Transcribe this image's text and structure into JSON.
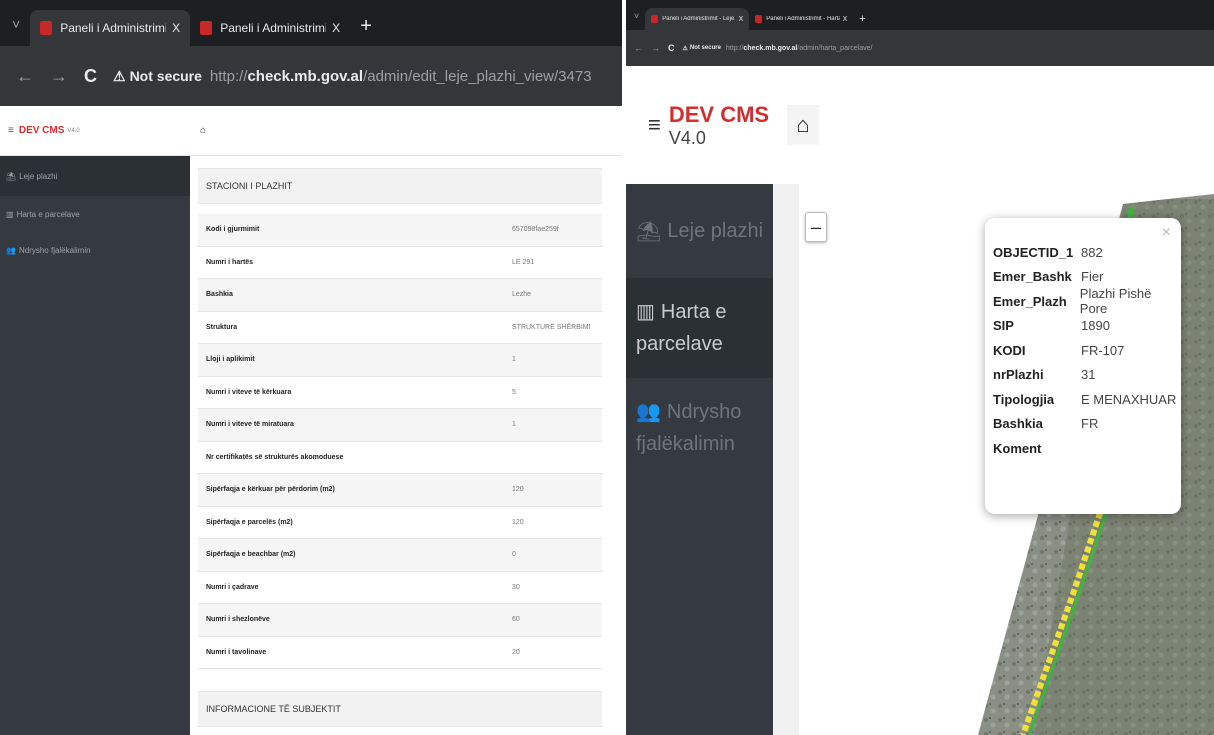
{
  "left": {
    "tabs": [
      {
        "title": "Paneli i Administrimit - Leje Pla",
        "close": "X"
      },
      {
        "title": "Paneli i Administrimit - Ndrysh",
        "close": "X"
      }
    ],
    "new_tab": "+",
    "tab_dropdown": "˅",
    "nav": {
      "back": "←",
      "forward": "→",
      "reload": "C"
    },
    "address": {
      "not_secure": "Not secure",
      "scheme": "http://",
      "host": "check.mb.gov.al",
      "path": "/admin/edit_leje_plazhi_view/3473"
    },
    "cms": {
      "menu": "≡",
      "brand": "DEV CMS",
      "version": "V4.0",
      "home_icon": "⌂"
    },
    "sidebar": [
      {
        "icon": "⛱",
        "label": "Leje plazhi"
      },
      {
        "icon": "▥",
        "label": "Harta e parcelave"
      },
      {
        "icon": "👥",
        "label": "Ndrysho fjalëkalimin"
      }
    ],
    "section1": "STACIONI I PLAZHIT",
    "rows": [
      {
        "k": "Kodi i gjurmimit",
        "v": "657098fae259f"
      },
      {
        "k": "Numri i hartës",
        "v": "LE 291"
      },
      {
        "k": "Bashkia",
        "v": "Lezhe"
      },
      {
        "k": "Struktura",
        "v": "STRUKTURË SHËRBIMI"
      },
      {
        "k": "Lloji i aplikimit",
        "v": "1"
      },
      {
        "k": "Numri i viteve të kërkuara",
        "v": "5"
      },
      {
        "k": "Numri i viteve të miratuara",
        "v": "1"
      },
      {
        "k": "Nr certifikatës së strukturës akomoduese",
        "v": ""
      },
      {
        "k": "Sipërfaqja e kërkuar për përdorim (m2)",
        "v": "120"
      },
      {
        "k": "Sipërfaqja e parcelës (m2)",
        "v": "120"
      },
      {
        "k": "Sipërfaqja e beachbar (m2)",
        "v": "0"
      },
      {
        "k": "Numri i çadrave",
        "v": "30"
      },
      {
        "k": "Numri i shezlonëve",
        "v": "60"
      },
      {
        "k": "Numri i tavolinave",
        "v": "20"
      }
    ],
    "section2": "INFORMACIONE TË SUBJEKTIT"
  },
  "right": {
    "tabs": [
      {
        "title": "Paneli i Administrimit - Leje Pla",
        "close": "X"
      },
      {
        "title": "Paneli i Administrimit - Harta e",
        "close": "X"
      }
    ],
    "new_tab": "+",
    "tab_dropdown": "˅",
    "nav": {
      "back": "←",
      "forward": "→",
      "reload": "C"
    },
    "address": {
      "not_secure": "Not secure",
      "scheme": "http://",
      "host": "check.mb.gov.al",
      "path": "/admin/harta_parcelave/"
    },
    "cms": {
      "menu": "≡",
      "brand": "DEV CMS",
      "version": "V4.0",
      "home_icon": "⌂"
    },
    "sidebar": [
      {
        "icon": "⛱",
        "label": "Leje plazhi"
      },
      {
        "icon": "▥",
        "label": "Harta e parcelave"
      },
      {
        "icon": "👥",
        "label": "Ndrysho fjalëkalimin"
      }
    ],
    "zoom_out": "–",
    "popup": {
      "close": "×",
      "rows": [
        {
          "k": "OBJECTID_1",
          "v": "882"
        },
        {
          "k": "Emer_Bashk",
          "v": "Fier"
        },
        {
          "k": "Emer_Plazh",
          "v": "Plazhi Pishë Pore"
        },
        {
          "k": "SIP",
          "v": "1890"
        },
        {
          "k": "KODI",
          "v": "FR-107"
        },
        {
          "k": "nrPlazhi",
          "v": "31"
        },
        {
          "k": "Tipologjia",
          "v": "E MENAXHUAR"
        },
        {
          "k": "Bashkia",
          "v": "FR"
        },
        {
          "k": "Koment",
          "v": ""
        }
      ]
    }
  },
  "colors": {
    "brand": "#d32f2f",
    "sidebar": "#343a40",
    "chrome_bar": "#1e1f22"
  }
}
